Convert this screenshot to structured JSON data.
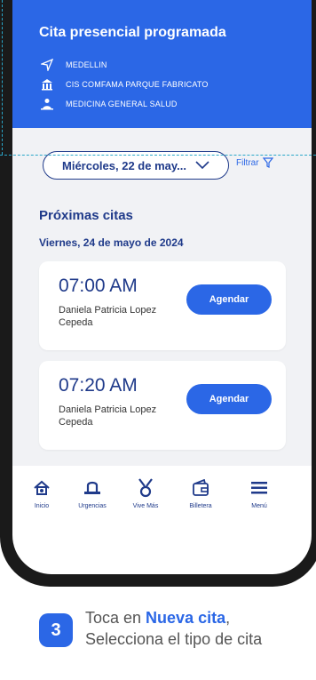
{
  "header": {
    "top_text": "",
    "title": "Cita presencial programada",
    "rows": [
      {
        "icon": "navigation-icon",
        "text": "MEDELLIN"
      },
      {
        "icon": "building-icon",
        "text": "CIS COMFAMA PARQUE FABRICATO"
      },
      {
        "icon": "doctor-icon",
        "text": "MEDICINA GENERAL SALUD"
      }
    ]
  },
  "filters": {
    "date_select": "Miércoles, 22 de may...",
    "filter_label": "Filtrar"
  },
  "appointments": {
    "section_title": "Próximas citas",
    "date_label": "Viernes, 24 de mayo de 2024",
    "cards": [
      {
        "time": "07:00 AM",
        "name": "Daniela Patricia Lopez Cepeda",
        "button": "Agendar"
      },
      {
        "time": "07:20 AM",
        "name": "Daniela Patricia Lopez Cepeda",
        "button": "Agendar"
      }
    ]
  },
  "nav": {
    "items": [
      {
        "label": "Inicio",
        "icon": "home-icon"
      },
      {
        "label": "Urgencias",
        "icon": "urgencias-icon"
      },
      {
        "label": "Vive Más",
        "icon": "medal-icon"
      },
      {
        "label": "Billetera",
        "icon": "wallet-icon"
      },
      {
        "label": "Menú",
        "icon": "menu-icon"
      }
    ]
  },
  "instruction": {
    "step_number": "3",
    "line1_prefix": "Toca en ",
    "line1_highlight": "Nueva cita",
    "line1_suffix": ",",
    "line2": "Selecciona el tipo de cita"
  },
  "colors": {
    "primary": "#2b67e6",
    "dark_blue": "#1f3a8a",
    "background_gray": "#f1f2f5"
  }
}
